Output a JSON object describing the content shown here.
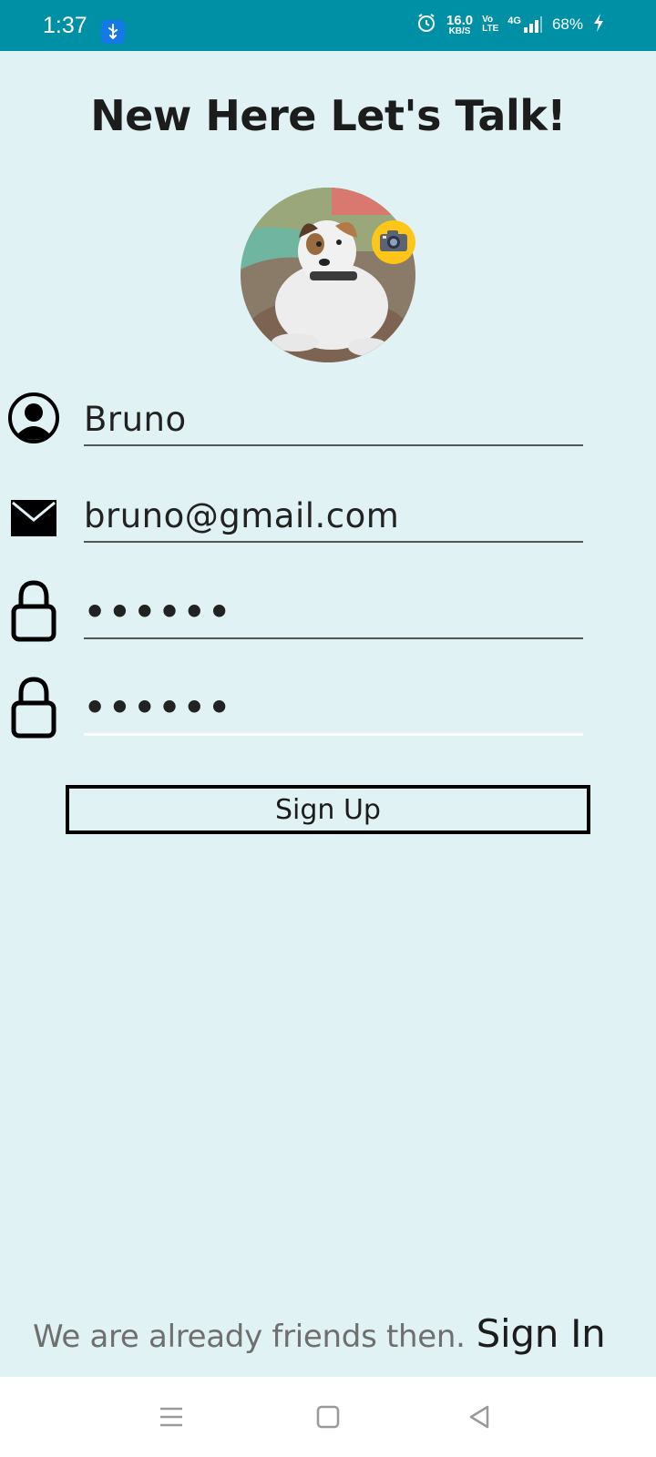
{
  "status_bar": {
    "time": "1:37",
    "network_speed": "16.0",
    "network_speed_unit": "KB/S",
    "volte_top": "Vo",
    "volte_bottom": "LTE",
    "network_type": "4G",
    "battery": "68%",
    "background_color": "#0090a6"
  },
  "header": {
    "title": "New Here Let's Talk!"
  },
  "avatar": {
    "camera_badge_color": "#ffc61a"
  },
  "form": {
    "name_value": "Bruno",
    "email_value": "bruno@gmail.com",
    "password_value": "••••••",
    "confirm_password_value": "••••••"
  },
  "signup_button": {
    "label": "Sign Up"
  },
  "footer": {
    "prompt": "We are already friends then.",
    "sign_in_label": "Sign In"
  },
  "colors": {
    "background": "#e1f2f4",
    "text": "#1c1c1c",
    "muted_text": "#6f6f6f"
  },
  "icons": {
    "name": "person-circle-icon",
    "email": "envelope-icon",
    "password": "lock-icon",
    "confirm_password": "lock-icon",
    "camera": "camera-icon"
  }
}
